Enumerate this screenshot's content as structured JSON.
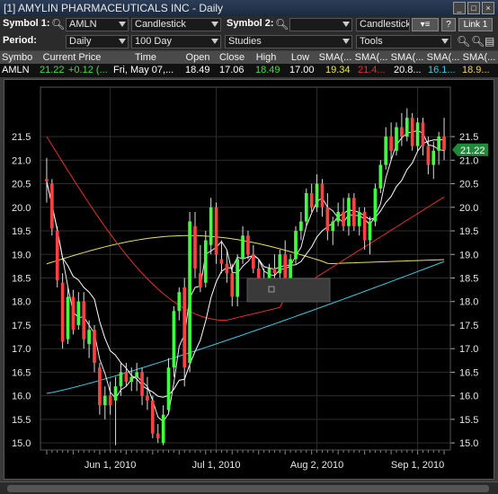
{
  "window": {
    "title": "[1] AMYLIN PHARMACEUTICALS INC - Daily"
  },
  "toolbar": {
    "symbol1_label": "Symbol 1:",
    "symbol1_value": "AMLN",
    "chart_type1": "Candlestick",
    "symbol2_label": "Symbol 2:",
    "symbol2_value": "",
    "chart_type2": "Candlestick",
    "help_label": "?",
    "link_label": "Link 1",
    "period_label": "Period:",
    "period_value": "Daily",
    "range_value": "100 Day",
    "studies_value": "Studies",
    "tools_value": "Tools"
  },
  "quote": {
    "headers": [
      "Symbol",
      "Current Price",
      "Time",
      "Open",
      "Close",
      "High",
      "Low",
      "SMA(...",
      "SMA(...",
      "SMA(...",
      "SMA(...",
      "SMA(..."
    ],
    "values": [
      "AMLN",
      "21.22",
      "+0.12 (...",
      "Fri, May 07,...",
      "18.49",
      "17.06",
      "18.49",
      "17.00",
      "19.34",
      "21.4...",
      "20.8...",
      "16.1...",
      "18.9..."
    ],
    "colors": {
      "price": "#44dd44",
      "sma1": "#e8e84a",
      "sma2": "#e03030",
      "sma3": "#ffffff",
      "sma4": "#40c8e0",
      "sma5": "#f0d060"
    }
  },
  "chart_data": {
    "type": "candlestick",
    "y_ticks": [
      15.0,
      15.5,
      16.0,
      16.5,
      17.0,
      17.5,
      18.0,
      18.5,
      19.0,
      19.5,
      20.0,
      20.5,
      21.0,
      21.5
    ],
    "ylim": [
      14.85,
      22.55
    ],
    "x_ticks": [
      "Jun 1, 2010",
      "Jul 1, 2010",
      "Aug 2, 2010",
      "Sep 1, 2010"
    ],
    "last_price_label": "21.22",
    "grid": true,
    "colors": {
      "up": "#40ff40",
      "down": "#ff4040",
      "sma_red": "#e03030",
      "sma_white": "#ffffff",
      "sma_yellow": "#e8e060",
      "sma_cyan": "#40c8e0",
      "sma_fast": "#f0f0f0"
    },
    "candles": [
      [
        20.6,
        21.05,
        20.1,
        20.55
      ],
      [
        20.5,
        20.6,
        19.4,
        19.55
      ],
      [
        19.5,
        19.6,
        18.3,
        18.45
      ],
      [
        18.4,
        18.6,
        17.0,
        17.15
      ],
      [
        17.2,
        18.3,
        17.1,
        18.1
      ],
      [
        18.1,
        18.25,
        17.3,
        17.4
      ],
      [
        17.5,
        18.2,
        17.4,
        18.0
      ],
      [
        18.0,
        18.2,
        17.0,
        17.2
      ],
      [
        17.1,
        17.6,
        16.8,
        17.4
      ],
      [
        17.4,
        17.5,
        16.5,
        16.7
      ],
      [
        16.6,
        16.7,
        15.6,
        15.8
      ],
      [
        15.8,
        16.2,
        15.5,
        16.0
      ],
      [
        16.0,
        16.3,
        15.6,
        15.8
      ],
      [
        15.9,
        16.4,
        14.95,
        16.2
      ],
      [
        16.2,
        16.7,
        16.0,
        16.5
      ],
      [
        16.5,
        16.7,
        16.2,
        16.3
      ],
      [
        16.3,
        16.6,
        16.1,
        16.4
      ],
      [
        16.4,
        16.7,
        16.1,
        16.5
      ],
      [
        16.5,
        16.6,
        15.8,
        16.0
      ],
      [
        16.0,
        16.4,
        15.7,
        15.9
      ],
      [
        15.9,
        16.0,
        15.1,
        15.2
      ],
      [
        15.2,
        15.4,
        15.0,
        15.1
      ],
      [
        15.0,
        15.8,
        14.95,
        15.6
      ],
      [
        15.7,
        16.8,
        15.6,
        16.6
      ],
      [
        16.6,
        17.9,
        16.4,
        17.8
      ],
      [
        17.8,
        18.3,
        17.6,
        18.2
      ],
      [
        18.3,
        18.5,
        16.2,
        16.6
      ],
      [
        16.7,
        19.9,
        16.5,
        19.7
      ],
      [
        19.6,
        19.9,
        18.5,
        18.7
      ],
      [
        18.6,
        19.2,
        18.2,
        18.3
      ],
      [
        18.4,
        19.5,
        18.3,
        19.3
      ],
      [
        19.2,
        20.2,
        19.0,
        20.0
      ],
      [
        20.0,
        20.1,
        18.8,
        19.0
      ],
      [
        18.9,
        19.3,
        18.6,
        18.8
      ],
      [
        18.8,
        19.1,
        18.4,
        18.6
      ],
      [
        18.6,
        18.8,
        17.9,
        18.1
      ],
      [
        18.1,
        19.0,
        17.9,
        18.9
      ],
      [
        18.9,
        19.6,
        18.8,
        19.4
      ],
      [
        19.4,
        19.5,
        18.9,
        19.0
      ],
      [
        19.0,
        19.2,
        18.6,
        18.7
      ],
      [
        18.7,
        18.9,
        18.3,
        18.5
      ],
      [
        18.5,
        18.7,
        18.3,
        18.4
      ],
      [
        18.4,
        18.8,
        18.3,
        18.7
      ],
      [
        18.7,
        19.0,
        18.5,
        18.6
      ],
      [
        18.6,
        19.1,
        18.5,
        19.0
      ],
      [
        19.0,
        19.3,
        18.4,
        18.5
      ],
      [
        18.5,
        19.0,
        18.4,
        18.9
      ],
      [
        18.9,
        19.6,
        18.8,
        19.5
      ],
      [
        19.5,
        19.9,
        19.3,
        19.7
      ],
      [
        19.7,
        20.4,
        19.6,
        20.3
      ],
      [
        20.3,
        20.5,
        19.9,
        20.0
      ],
      [
        20.0,
        20.7,
        19.9,
        20.5
      ],
      [
        20.5,
        20.6,
        19.8,
        20.0
      ],
      [
        20.0,
        20.3,
        19.3,
        19.5
      ],
      [
        19.5,
        19.8,
        19.2,
        19.7
      ],
      [
        19.7,
        20.1,
        19.6,
        19.9
      ],
      [
        19.9,
        20.2,
        19.5,
        19.6
      ],
      [
        19.6,
        20.3,
        19.4,
        20.2
      ],
      [
        20.2,
        20.3,
        19.5,
        19.6
      ],
      [
        19.6,
        20.0,
        19.4,
        19.9
      ],
      [
        19.9,
        20.0,
        19.1,
        19.3
      ],
      [
        19.3,
        19.8,
        19.0,
        19.7
      ],
      [
        19.7,
        20.5,
        19.6,
        20.4
      ],
      [
        20.4,
        21.0,
        20.3,
        20.9
      ],
      [
        20.9,
        21.7,
        20.8,
        21.5
      ],
      [
        21.5,
        21.8,
        21.0,
        21.2
      ],
      [
        21.2,
        21.8,
        21.1,
        21.7
      ],
      [
        21.7,
        22.0,
        21.3,
        21.5
      ],
      [
        21.5,
        22.1,
        21.4,
        21.9
      ],
      [
        21.9,
        22.0,
        21.2,
        21.3
      ],
      [
        21.3,
        21.9,
        21.2,
        21.8
      ],
      [
        21.8,
        21.9,
        21.1,
        21.3
      ],
      [
        21.3,
        21.5,
        20.7,
        20.9
      ],
      [
        20.9,
        21.4,
        20.6,
        21.2
      ],
      [
        21.2,
        21.6,
        20.9,
        21.5
      ],
      [
        21.5,
        21.9,
        21.0,
        21.22
      ]
    ]
  },
  "statusbar": {
    "label": ""
  }
}
